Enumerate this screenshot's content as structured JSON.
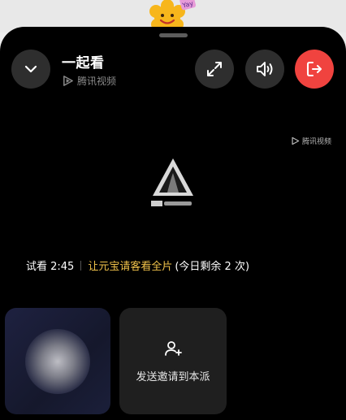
{
  "header": {
    "title": "一起看",
    "source_label": "腾讯视频"
  },
  "controls": {
    "collapse_icon": "chevron-down-icon",
    "fullscreen_icon": "expand-icon",
    "volume_icon": "volume-icon",
    "exit_icon": "exit-icon",
    "exit_color": "#f0433f"
  },
  "video": {
    "watermark_label": "腾讯视频"
  },
  "trial": {
    "time_label": "试看 2:45",
    "invite_link": "让元宝请客看全片",
    "remaining_label": "(今日剩余 2 次)",
    "link_color": "#f0c24a"
  },
  "participants": {
    "invite_label": "发送邀请到本派",
    "invite_icon": "add-user-icon"
  }
}
